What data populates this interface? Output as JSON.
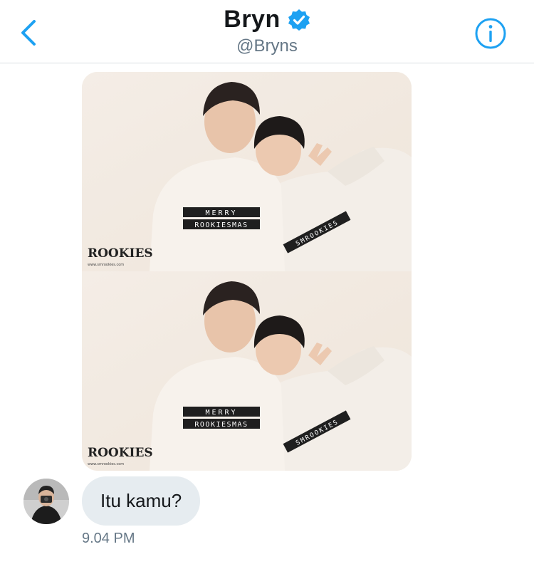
{
  "header": {
    "title": "Bryn",
    "handle": "@Bryns",
    "back_icon": "chevron-left-icon",
    "verified_icon": "verified-badge-icon",
    "info_icon": "info-icon"
  },
  "colors": {
    "accent": "#1da1f2",
    "bubble": "#e6ecf0",
    "meta_text": "#657786",
    "divider": "#d8dde2"
  },
  "media": {
    "panels": [
      {
        "shirt_left_line1": "MERRY",
        "shirt_left_line2": "ROOKIESMAS",
        "shirt_right": "SMROOKIES",
        "logo": "ROOKIES",
        "logo_url": "www.smrookies.com"
      },
      {
        "shirt_left_line1": "MERRY",
        "shirt_left_line2": "ROOKIESMAS",
        "shirt_right": "SMROOKIES",
        "logo": "ROOKIES",
        "logo_url": "www.smrookies.com"
      }
    ]
  },
  "message": {
    "text": "Itu kamu?",
    "time": "9.04 PM"
  }
}
